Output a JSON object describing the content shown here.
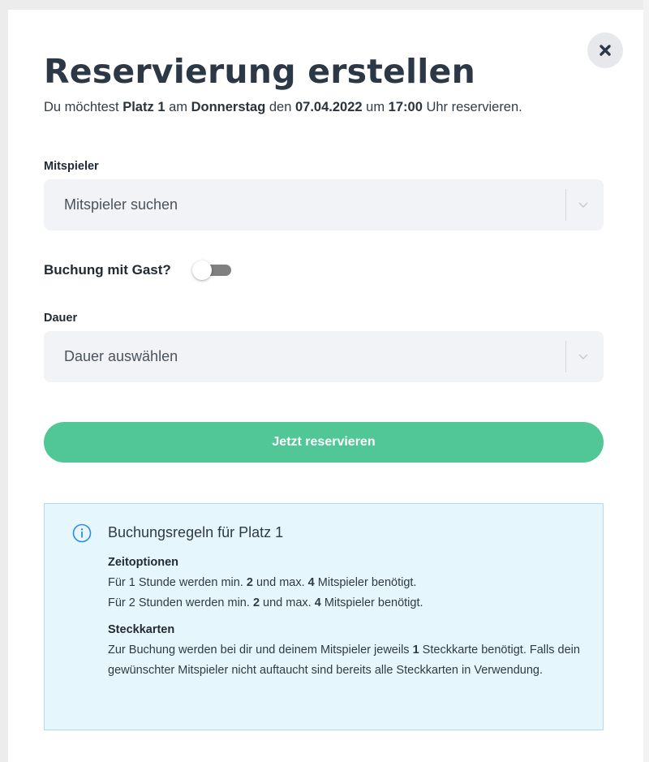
{
  "modal": {
    "title": "Reservierung erstellen",
    "subtitle": {
      "t1": "Du möchtest ",
      "court": "Platz 1",
      "t2": " am ",
      "day": "Donnerstag",
      "t3": " den ",
      "date": "07.04.2022",
      "t4": " um ",
      "time": "17:00",
      "t5": " Uhr reservieren."
    },
    "close_icon": "close-icon"
  },
  "players": {
    "label": "Mitspieler",
    "placeholder": "Mitspieler suchen"
  },
  "guest": {
    "label": "Buchung mit Gast?",
    "enabled": false
  },
  "duration": {
    "label": "Dauer",
    "placeholder": "Dauer auswählen"
  },
  "submit": {
    "label": "Jetzt reservieren",
    "color": "#51c797"
  },
  "rules": {
    "icon": "info-icon",
    "heading": "Buchungsregeln für Platz 1",
    "time_options": {
      "title": "Zeitoptionen",
      "r1": {
        "a": "Für 1 Stunde werden min. ",
        "min": "2",
        "b": " und max. ",
        "max": "4",
        "c": " Mitspieler benötigt."
      },
      "r2": {
        "a": "Für 2 Stunden werden min. ",
        "min": "2",
        "b": " und max. ",
        "max": "4",
        "c": " Mitspieler benötigt."
      }
    },
    "cards": {
      "title": "Steckkarten",
      "a": "Zur Buchung werden bei dir und deinem Mitspieler jeweils ",
      "count": "1",
      "b": " Steckkarte benötigt. Falls dein gewünschter Mitspieler nicht auftaucht sind bereits alle Steckkarten in Verwendung."
    },
    "bg_color": "#e6f6fd",
    "border_color": "#aedcf3"
  }
}
